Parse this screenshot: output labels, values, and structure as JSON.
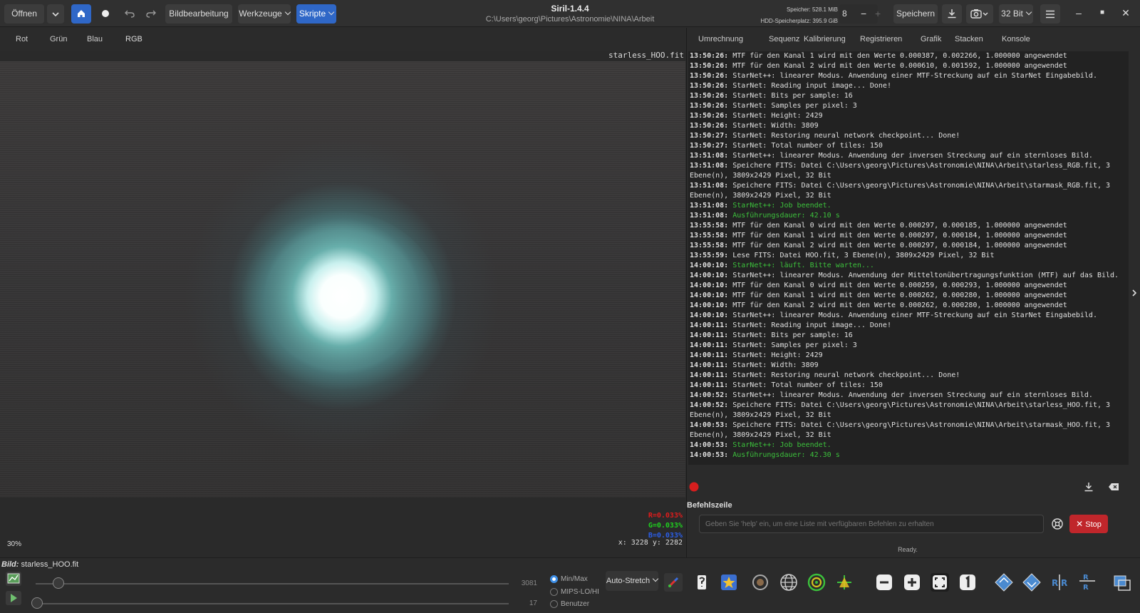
{
  "app": {
    "title": "Siril-1.4.4",
    "path": "C:\\Users\\georg\\Pictures\\Astronomie\\NINA\\Arbeit",
    "memory": "Speicher: 528.1 MiB",
    "disk": "HDD-Speicherplatz: 395.9 GiB"
  },
  "toolbar": {
    "open_label": "Öffnen",
    "image_processing_label": "Bildbearbeitung",
    "tools_label": "Werkzeuge",
    "scripts_label": "Skripte",
    "threads_value": "8",
    "save_label": "Speichern",
    "bitdepth_label": "32 Bit"
  },
  "image_tabs": [
    "Rot",
    "Grün",
    "Blau",
    "RGB"
  ],
  "image_tab_active": "RGB",
  "viewer": {
    "filename": "starless_HOO.fit",
    "r_value": "R=0.033%",
    "g_value": "G=0.033%",
    "b_value": "B=0.033%",
    "zoom": "30%",
    "coords": "x: 3228 y: 2282"
  },
  "panel_tabs": [
    "Umrechnung",
    "Sequenz",
    "Kalibrierung",
    "Registrieren",
    "Grafik",
    "Stacken",
    "Konsole"
  ],
  "panel_tab_active": "Konsole",
  "console": [
    {
      "t": "13:50:26:",
      "m": "MTF für den Kanal 1 wird mit den Werte 0.000387, 0.002266, 1.000000 angewendet",
      "c": ""
    },
    {
      "t": "13:50:26:",
      "m": "MTF für den Kanal 2 wird mit den Werte 0.000610, 0.001592, 1.000000 angewendet",
      "c": ""
    },
    {
      "t": "13:50:26:",
      "m": "StarNet++: linearer Modus. Anwendung einer MTF-Streckung auf ein StarNet Eingabebild.",
      "c": ""
    },
    {
      "t": "13:50:26:",
      "m": "StarNet: Reading input image... Done!",
      "c": ""
    },
    {
      "t": "13:50:26:",
      "m": "StarNet: Bits per sample: 16",
      "c": ""
    },
    {
      "t": "13:50:26:",
      "m": "StarNet: Samples per pixel: 3",
      "c": ""
    },
    {
      "t": "13:50:26:",
      "m": "StarNet: Height: 2429",
      "c": ""
    },
    {
      "t": "13:50:26:",
      "m": "StarNet: Width: 3809",
      "c": ""
    },
    {
      "t": "13:50:27:",
      "m": "StarNet: Restoring neural network checkpoint... Done!",
      "c": ""
    },
    {
      "t": "13:50:27:",
      "m": "StarNet: Total number of tiles: 150",
      "c": ""
    },
    {
      "t": "13:51:08:",
      "m": "StarNet++: linearer Modus. Anwendung der inversen Streckung auf ein sternloses Bild.",
      "c": ""
    },
    {
      "t": "13:51:08:",
      "m": "Speichere FITS: Datei C:\\Users\\georg\\Pictures\\Astronomie\\NINA\\Arbeit\\starless_RGB.fit, 3",
      "c": ""
    },
    {
      "t": "",
      "m": "Ebene(n), 3809x2429 Pixel, 32 Bit",
      "c": ""
    },
    {
      "t": "13:51:08:",
      "m": "Speichere FITS: Datei C:\\Users\\georg\\Pictures\\Astronomie\\NINA\\Arbeit\\starmask_RGB.fit, 3",
      "c": ""
    },
    {
      "t": "",
      "m": "Ebene(n), 3809x2429 Pixel, 32 Bit",
      "c": ""
    },
    {
      "t": "13:51:08:",
      "m": "StarNet++: Job beendet.",
      "c": "green"
    },
    {
      "t": "13:51:08:",
      "m": "Ausführungsdauer: 42.10 s",
      "c": "green"
    },
    {
      "t": "13:55:58:",
      "m": "MTF für den Kanal 0 wird mit den Werte 0.000297, 0.000185, 1.000000 angewendet",
      "c": ""
    },
    {
      "t": "13:55:58:",
      "m": "MTF für den Kanal 1 wird mit den Werte 0.000297, 0.000184, 1.000000 angewendet",
      "c": ""
    },
    {
      "t": "13:55:58:",
      "m": "MTF für den Kanal 2 wird mit den Werte 0.000297, 0.000184, 1.000000 angewendet",
      "c": ""
    },
    {
      "t": "13:55:59:",
      "m": "Lese FITS: Datei HOO.fit, 3 Ebene(n), 3809x2429 Pixel, 32 Bit",
      "c": ""
    },
    {
      "t": "14:00:10:",
      "m": "StarNet++: läuft. Bitte warten...",
      "c": "green"
    },
    {
      "t": "14:00:10:",
      "m": "StarNet++: linearer Modus. Anwendung der Mitteltonübertragungsfunktion (MTF) auf das Bild.",
      "c": ""
    },
    {
      "t": "14:00:10:",
      "m": "MTF für den Kanal 0 wird mit den Werte 0.000259, 0.000293, 1.000000 angewendet",
      "c": ""
    },
    {
      "t": "14:00:10:",
      "m": "MTF für den Kanal 1 wird mit den Werte 0.000262, 0.000280, 1.000000 angewendet",
      "c": ""
    },
    {
      "t": "14:00:10:",
      "m": "MTF für den Kanal 2 wird mit den Werte 0.000262, 0.000280, 1.000000 angewendet",
      "c": ""
    },
    {
      "t": "14:00:10:",
      "m": "StarNet++: linearer Modus. Anwendung einer MTF-Streckung auf ein StarNet Eingabebild.",
      "c": ""
    },
    {
      "t": "14:00:11:",
      "m": "StarNet: Reading input image... Done!",
      "c": ""
    },
    {
      "t": "14:00:11:",
      "m": "StarNet: Bits per sample: 16",
      "c": ""
    },
    {
      "t": "14:00:11:",
      "m": "StarNet: Samples per pixel: 3",
      "c": ""
    },
    {
      "t": "14:00:11:",
      "m": "StarNet: Height: 2429",
      "c": ""
    },
    {
      "t": "14:00:11:",
      "m": "StarNet: Width: 3809",
      "c": ""
    },
    {
      "t": "14:00:11:",
      "m": "StarNet: Restoring neural network checkpoint... Done!",
      "c": ""
    },
    {
      "t": "14:00:11:",
      "m": "StarNet: Total number of tiles: 150",
      "c": ""
    },
    {
      "t": "14:00:52:",
      "m": "StarNet++: linearer Modus. Anwendung der inversen Streckung auf ein sternloses Bild.",
      "c": ""
    },
    {
      "t": "14:00:52:",
      "m": "Speichere FITS: Datei C:\\Users\\georg\\Pictures\\Astronomie\\NINA\\Arbeit\\starless_HOO.fit, 3",
      "c": ""
    },
    {
      "t": "",
      "m": "Ebene(n), 3809x2429 Pixel, 32 Bit",
      "c": ""
    },
    {
      "t": "14:00:53:",
      "m": "Speichere FITS: Datei C:\\Users\\georg\\Pictures\\Astronomie\\NINA\\Arbeit\\starmask_HOO.fit, 3",
      "c": ""
    },
    {
      "t": "",
      "m": "Ebene(n), 3809x2429 Pixel, 32 Bit",
      "c": ""
    },
    {
      "t": "14:00:53:",
      "m": "StarNet++: Job beendet.",
      "c": "green"
    },
    {
      "t": "14:00:53:",
      "m": "Ausführungsdauer: 42.30 s",
      "c": "green"
    }
  ],
  "command": {
    "label": "Befehlszeile",
    "placeholder": "Geben Sie 'help' ein, um eine Liste mit verfügbaren Befehlen zu erhalten",
    "stop_label": "Stop",
    "status": "Ready."
  },
  "bottom": {
    "image_label": "Bild:",
    "image_name": "starless_HOO.fit",
    "slider_high_value": "3081",
    "slider_low_value": "17",
    "mode_options": [
      "Min/Max",
      "MIPS-LO/HI",
      "Benutzer"
    ],
    "mode_selected": "Min/Max",
    "stretch_label": "Auto-Stretch"
  },
  "colors": {
    "accent": "#3d8ee6",
    "scripts_button": "#2f67c7",
    "stop_button": "#c0262b",
    "console_green": "#3cc13c",
    "r_value": "#e01c1c",
    "g_value": "#1fd11f",
    "b_value": "#2a5ee8"
  }
}
